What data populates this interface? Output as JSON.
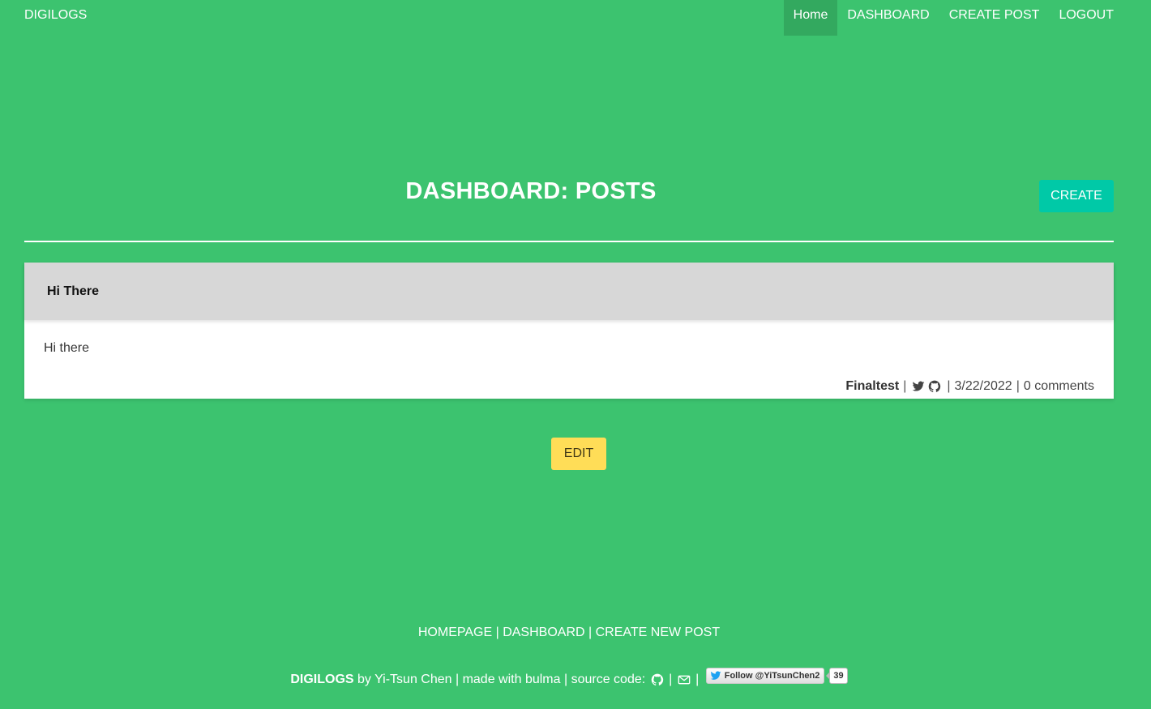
{
  "navbar": {
    "brand": "DIGILOGS",
    "items": [
      {
        "label": "Home",
        "active": true
      },
      {
        "label": "DASHBOARD",
        "active": false
      },
      {
        "label": "CREATE POST",
        "active": false
      },
      {
        "label": "LOGOUT",
        "active": false
      }
    ]
  },
  "header": {
    "title": "DASHBOARD: POSTS",
    "create_label": "CREATE"
  },
  "post": {
    "title": "Hi There",
    "body": "Hi there",
    "author": "Finaltest",
    "date": "3/22/2022",
    "comments": "0 comments",
    "icons": [
      "twitter-icon",
      "github-icon"
    ]
  },
  "edit_label": "EDIT",
  "footer": {
    "links": [
      "HOMEPAGE",
      "DASHBOARD",
      "CREATE NEW POST"
    ],
    "brand": "DIGILOGS",
    "credit_by": " by Yi-Tsun Chen | made with bulma | source code: ",
    "twitter_follow": "Follow @YiTsunChen2",
    "twitter_count": "39"
  },
  "colors": {
    "background": "#3cc36f",
    "nav_active": "#33a95f",
    "create_button": "#00c9a7",
    "edit_button": "#ffdd57",
    "card_header": "#d7d7d7"
  }
}
